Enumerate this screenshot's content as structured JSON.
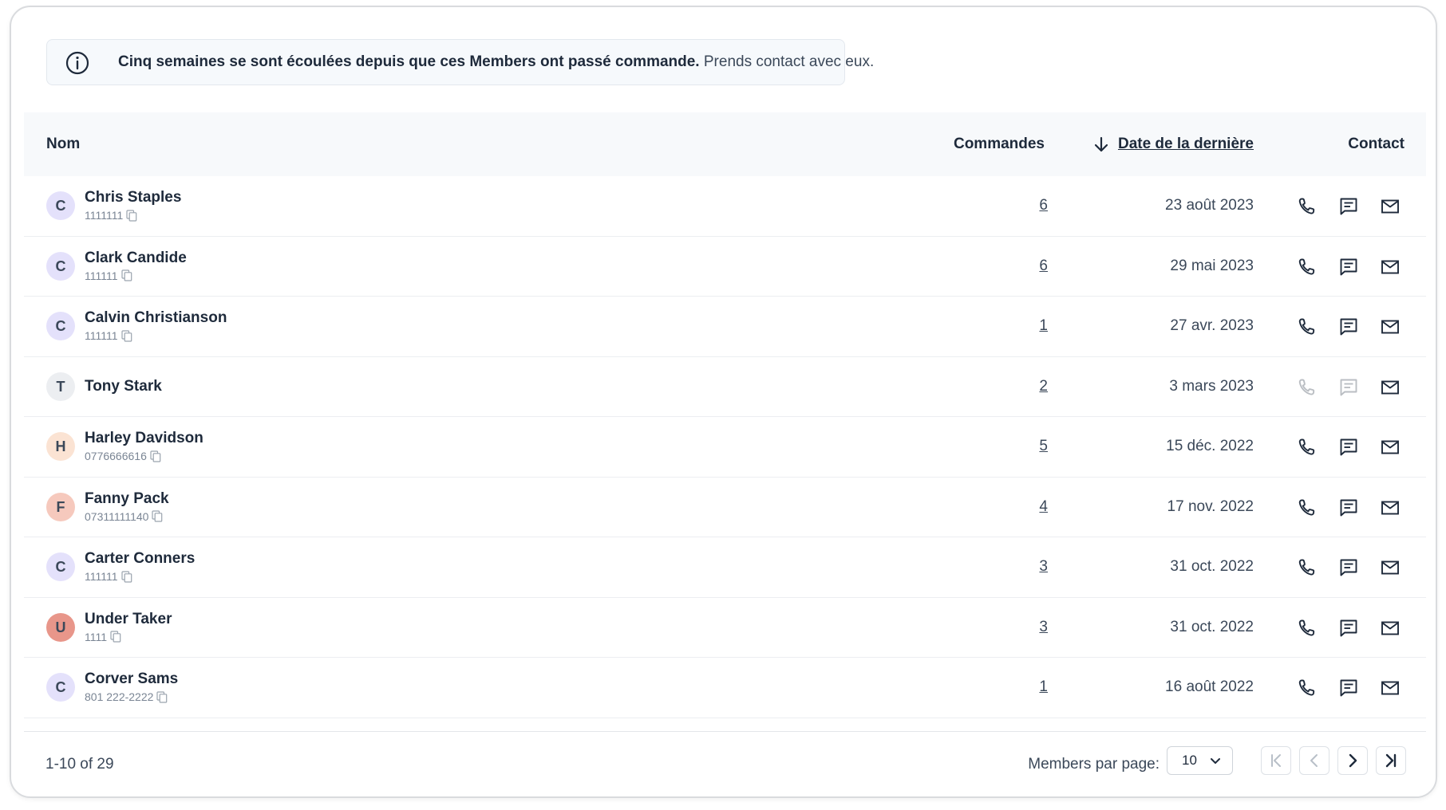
{
  "banner": {
    "bold_text": "Cinq semaines se sont écoulées depuis que ces Members ont passé commande.",
    "light_text": "Prends contact avec eux."
  },
  "table": {
    "headers": {
      "name": "Nom",
      "orders": "Commandes",
      "last_date": "Date de la dernière",
      "contact": "Contact"
    },
    "rows": [
      {
        "initial": "C",
        "name": "Chris Staples",
        "id": "1111111",
        "orders": "6",
        "date": "23 août 2023",
        "avatar_bg": "#e4e1fb",
        "phone_enabled": true,
        "sms_enabled": true
      },
      {
        "initial": "C",
        "name": "Clark Candide",
        "id": "111111",
        "orders": "6",
        "date": "29 mai 2023",
        "avatar_bg": "#e4e1fb",
        "phone_enabled": true,
        "sms_enabled": true
      },
      {
        "initial": "C",
        "name": "Calvin Christianson",
        "id": "111111",
        "orders": "1",
        "date": "27 avr. 2023",
        "avatar_bg": "#e4e1fb",
        "phone_enabled": true,
        "sms_enabled": true
      },
      {
        "initial": "T",
        "name": "Tony Stark",
        "id": "",
        "orders": "2",
        "date": "3 mars 2023",
        "avatar_bg": "#eceef1",
        "phone_enabled": false,
        "sms_enabled": false
      },
      {
        "initial": "H",
        "name": "Harley Davidson",
        "id": "0776666616",
        "orders": "5",
        "date": "15 déc. 2022",
        "avatar_bg": "#fbe3d3",
        "phone_enabled": true,
        "sms_enabled": true
      },
      {
        "initial": "F",
        "name": "Fanny Pack",
        "id": "07311111140",
        "orders": "4",
        "date": "17 nov. 2022",
        "avatar_bg": "#f6c9bd",
        "phone_enabled": true,
        "sms_enabled": true
      },
      {
        "initial": "C",
        "name": "Carter Conners",
        "id": "111111",
        "orders": "3",
        "date": "31 oct. 2022",
        "avatar_bg": "#e4e1fb",
        "phone_enabled": true,
        "sms_enabled": true
      },
      {
        "initial": "U",
        "name": "Under Taker",
        "id": "1111",
        "orders": "3",
        "date": "31 oct. 2022",
        "avatar_bg": "#e8968a",
        "phone_enabled": true,
        "sms_enabled": true
      },
      {
        "initial": "C",
        "name": "Corver Sams",
        "id": "801 222-2222",
        "orders": "1",
        "date": "16 août 2022",
        "avatar_bg": "#e4e1fb",
        "phone_enabled": true,
        "sms_enabled": true
      }
    ]
  },
  "footer": {
    "range": "1-10 of 29",
    "per_page_label": "Members par page:",
    "per_page_value": "10"
  },
  "icons": {
    "info": "info-icon",
    "sort": "arrow-down-icon",
    "phone": "phone-icon",
    "sms": "message-icon",
    "mail": "mail-icon",
    "copy": "copy-icon"
  }
}
